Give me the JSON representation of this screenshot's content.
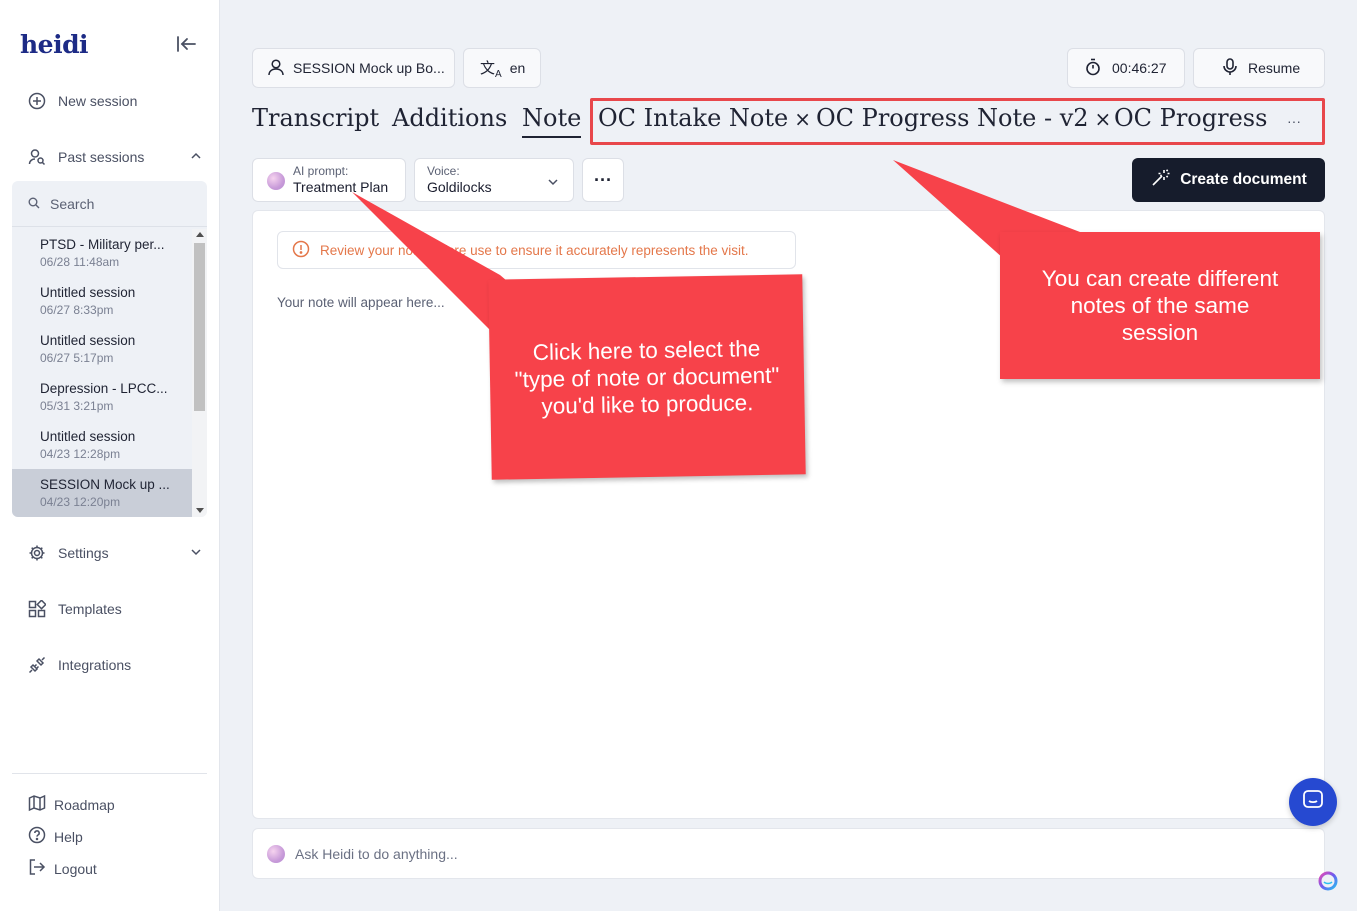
{
  "brand": {
    "name": "heidi"
  },
  "sidebar": {
    "new_session": "New session",
    "past_sessions": "Past sessions",
    "search_placeholder": "Search",
    "sessions": [
      {
        "title": "PTSD - Military per...",
        "date": "06/28 11:48am"
      },
      {
        "title": "Untitled session",
        "date": "06/27 8:33pm"
      },
      {
        "title": "Untitled session",
        "date": "06/27 5:17pm"
      },
      {
        "title": "Depression - LPCC...",
        "date": "05/31 3:21pm"
      },
      {
        "title": "Untitled session",
        "date": "04/23 12:28pm"
      },
      {
        "title": "SESSION Mock up ...",
        "date": "04/23 12:20pm",
        "active": true
      }
    ],
    "settings": "Settings",
    "templates": "Templates",
    "integrations": "Integrations",
    "roadmap": "Roadmap",
    "help": "Help",
    "logout": "Logout"
  },
  "header": {
    "session_name": "SESSION Mock up Bo...",
    "language": "en",
    "timer": "00:46:27",
    "resume": "Resume"
  },
  "tabs": [
    {
      "label": "Transcript"
    },
    {
      "label": "Additions"
    },
    {
      "label": "Note",
      "active": true
    },
    {
      "label": "OC Intake Note",
      "closable": true
    },
    {
      "label": "OC Progress Note - v2",
      "closable": true
    },
    {
      "label": "OC Progress Note",
      "closable": true
    }
  ],
  "tabs_more": "···",
  "toolbar": {
    "ai_prompt_label": "AI prompt:",
    "ai_prompt_value": "Treatment Plan",
    "voice_label": "Voice:",
    "voice_value": "Goldilocks",
    "more": "···",
    "create_document": "Create document"
  },
  "note": {
    "warning": "Review your note before use to ensure it accurately represents the visit.",
    "placeholder": "Your note will appear here..."
  },
  "ask": {
    "placeholder": "Ask Heidi to do anything..."
  },
  "callouts": {
    "left": "Click here to select the \"type of note or document\" you'd like to produce.",
    "right": "You can create different notes of the same session"
  },
  "colors": {
    "accent_dark": "#161c2c",
    "callout": "#f7424a",
    "brand": "#1d2b86",
    "chat": "#2649d1"
  }
}
